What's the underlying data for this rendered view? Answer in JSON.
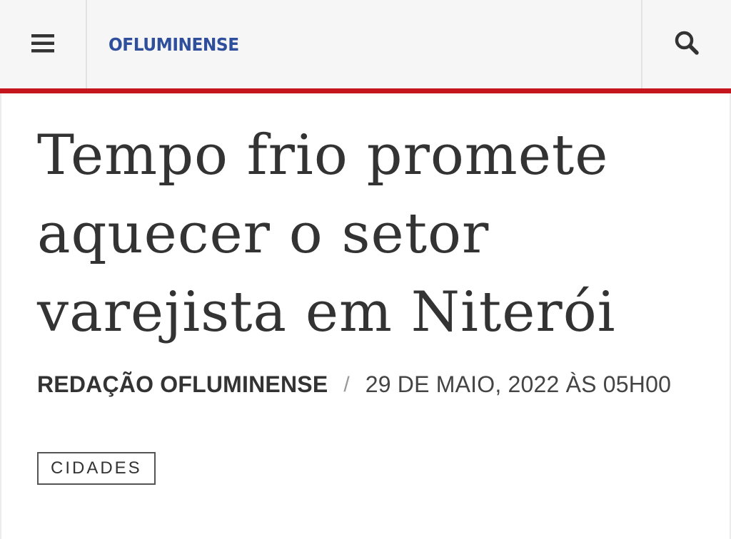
{
  "header": {
    "menu_icon": "hamburger-menu-icon",
    "logo_text": "OFLUMINENSE",
    "search_icon": "search-icon",
    "accent_color": "#c4161c",
    "logo_color": "#2f4f9d"
  },
  "article": {
    "title": "Tempo frio promete aquecer o setor varejista em Niterói",
    "author": "REDAÇÃO OFLUMINENSE",
    "separator": "/",
    "date": "29 DE MAIO, 2022 ÀS 05H00",
    "tag": "CIDADES"
  }
}
